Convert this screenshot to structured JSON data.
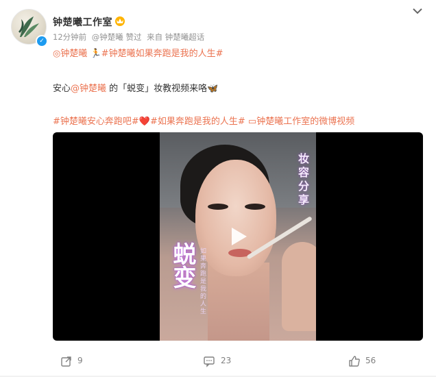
{
  "post": {
    "author": "钟楚曦工作室",
    "time": "12分钟前",
    "liked_by": "@钟楚曦 赞过",
    "source": "来自 钟楚曦超话"
  },
  "content": {
    "line1": [
      {
        "text": "◎钟楚曦",
        "type": "tag"
      },
      {
        "text": " 🏃",
        "type": "plain"
      },
      {
        "text": "#钟楚曦如果奔跑是我的人生#",
        "type": "tag"
      }
    ],
    "line2": [
      {
        "text": "安心",
        "type": "plain"
      },
      {
        "text": "@钟楚曦",
        "type": "tag"
      },
      {
        "text": " 的「蜕变」妆教视频来咯🦋",
        "type": "plain"
      }
    ],
    "line3": [
      {
        "text": "#钟楚曦安心奔跑吧#",
        "type": "tag"
      },
      {
        "text": "❤️",
        "type": "plain"
      },
      {
        "text": "#如果奔跑是我的人生#",
        "type": "tag"
      },
      {
        "text": " ▭钟楚曦工作室的微博视频",
        "type": "tag"
      }
    ]
  },
  "video": {
    "title_text": "蜕变",
    "side_text": "妆容分享",
    "sub_text": "如果奔跑是我的人生"
  },
  "actions": {
    "reposts": "9",
    "comments": "23",
    "likes": "56"
  },
  "icons": {
    "vip": "crown-badge-icon",
    "verified": "verified-badge-icon",
    "collapse": "chevron-down-icon",
    "play": "play-icon",
    "repost": "repost-icon",
    "comment": "comment-icon",
    "like": "thumbs-up-icon"
  },
  "colors": {
    "tag": "#eb7350",
    "text": "#333333",
    "meta": "#939393"
  }
}
